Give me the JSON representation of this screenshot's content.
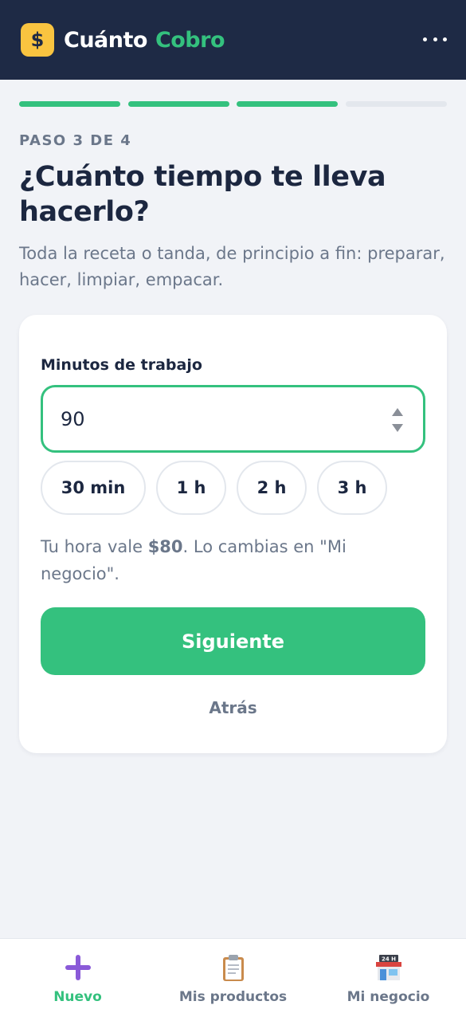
{
  "header": {
    "logo_symbol": "$",
    "brand_part1": "Cuánto",
    "brand_part2": "Cobro",
    "menu_icon": "more-horizontal-icon"
  },
  "progress": {
    "current_step": 3,
    "total_steps": 4
  },
  "step": {
    "label": "PASO 3 DE 4",
    "title": "¿Cuánto tiempo te lleva hacerlo?",
    "subtitle": "Toda la receta o tanda, de principio a fin: preparar, hacer, limpiar, empacar."
  },
  "form": {
    "field_label": "Minutos de trabajo",
    "minutes_value": "90",
    "chips": [
      "30 min",
      "1 h",
      "2 h",
      "3 h"
    ],
    "note_prefix": "Tu hora vale ",
    "note_rate": "$80",
    "note_suffix": ". Lo cambias en \"Mi negocio\".",
    "next_label": "Siguiente",
    "back_label": "Atrás"
  },
  "nav": {
    "items": [
      {
        "label": "Nuevo",
        "icon": "plus-icon",
        "active": true
      },
      {
        "label": "Mis productos",
        "icon": "clipboard-icon",
        "active": false
      },
      {
        "label": "Mi negocio",
        "icon": "store-24h-icon",
        "active": false
      }
    ]
  },
  "colors": {
    "accent": "#34c17e",
    "header_bg": "#1e2a45",
    "logo_bg": "#f9c440",
    "text_muted": "#6b778a"
  }
}
